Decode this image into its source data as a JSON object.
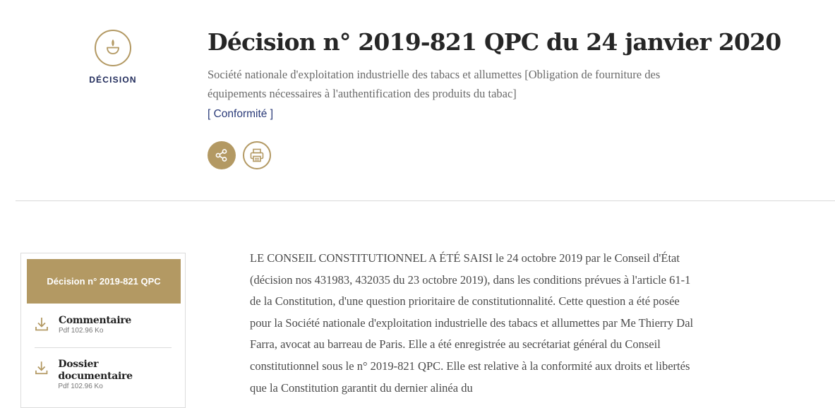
{
  "badge": {
    "label": "DÉCISION",
    "icon": "flame-lamp-icon"
  },
  "header": {
    "title": "Décision n° 2019-821 QPC du 24 janvier 2020",
    "subtitle": "Société nationale d'exploitation industrielle des tabacs et allumettes [Obligation de fourniture des équipements nécessaires à l'authentification des produits du tabac]",
    "tag": "[ Conformité ]"
  },
  "actions": {
    "share_icon": "share-icon",
    "print_icon": "print-icon"
  },
  "sidebar": {
    "header": "Décision n° 2019-821 QPC",
    "items": [
      {
        "title": "Commentaire",
        "size": "Pdf 102.96 Ko",
        "icon": "download-icon"
      },
      {
        "title": "Dossier documentaire",
        "size": "Pdf 102.96 Ko",
        "icon": "download-icon"
      }
    ]
  },
  "content": {
    "text": "LE CONSEIL CONSTITUTIONNEL A ÉTÉ SAISI le 24 octobre 2019 par le Conseil d'État (décision nos 431983, 432035 du 23 octobre 2019), dans les conditions prévues à l'article 61-1 de la Constitution, d'une question prioritaire de constitutionnalité. Cette question a été posée pour la Société nationale d'exploitation industrielle des tabacs et allumettes par Me Thierry Dal Farra, avocat au barreau de Paris. Elle a été enregistrée au secrétariat général du Conseil constitutionnel sous le n° 2019-821 QPC. Elle est relative à la conformité aux droits et libertés que la Constitution garantit du dernier alinéa du"
  },
  "colors": {
    "accent": "#b39963",
    "link": "#2a3a78",
    "badge_text": "#1f2a5a"
  }
}
